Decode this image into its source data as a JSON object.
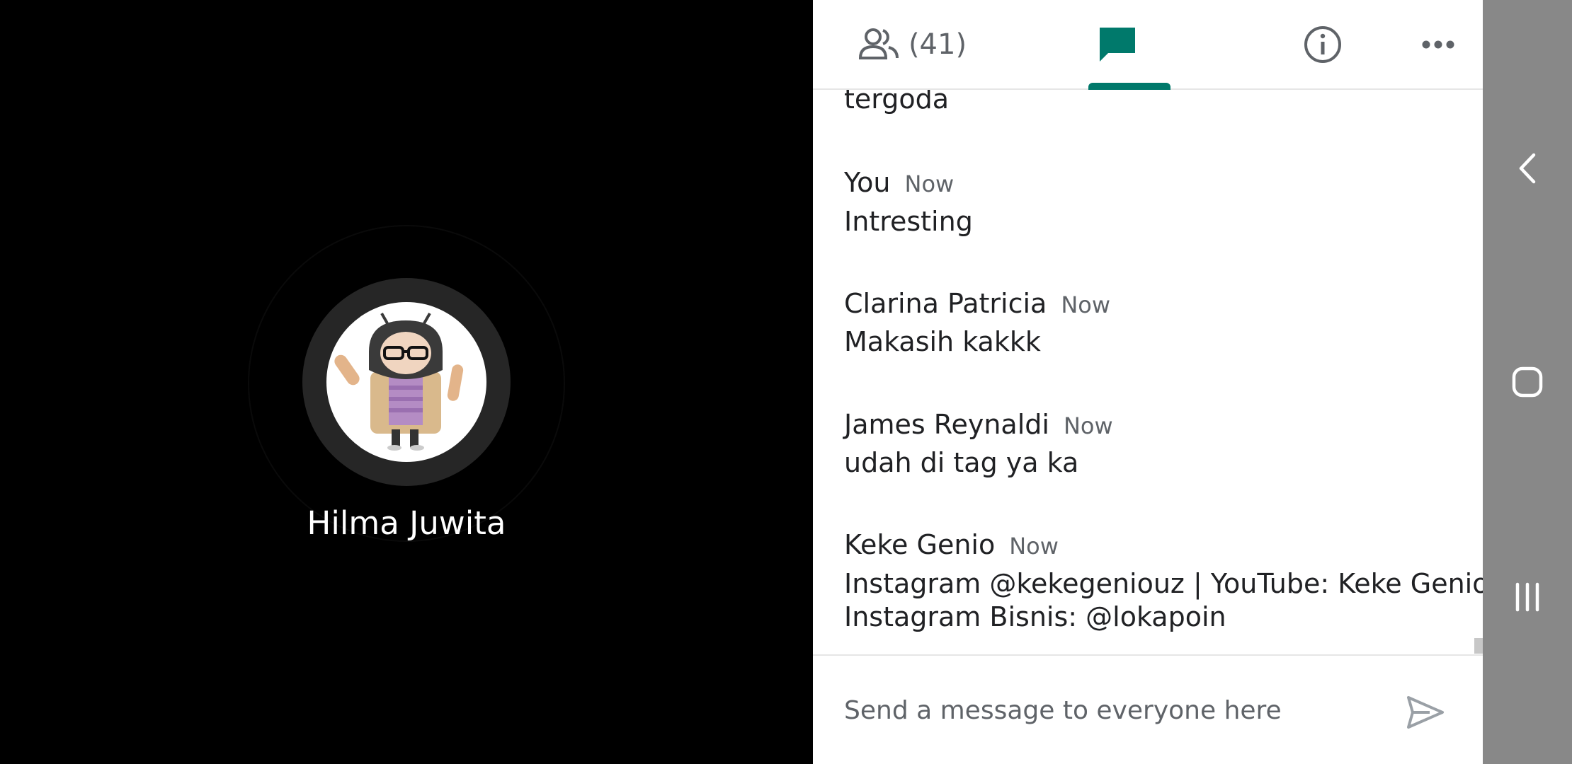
{
  "stage": {
    "participant_name": "Hilma Juwita",
    "avatar_icon": "android-girl-avatar-icon"
  },
  "tabs": {
    "people_count": "(41)",
    "people_icon": "people-icon",
    "chat_icon": "chat-icon",
    "info_icon": "info-icon",
    "more_icon": "more-horizontal-icon",
    "active": "chat"
  },
  "chat": {
    "partial_text": "tergoda",
    "messages": [
      {
        "sender": "You",
        "time": "Now",
        "lines": [
          "Intresting"
        ]
      },
      {
        "sender": "Clarina Patricia",
        "time": "Now",
        "lines": [
          "Makasih kakkk"
        ]
      },
      {
        "sender": "James Reynaldi",
        "time": "Now",
        "lines": [
          "udah di tag ya ka"
        ]
      },
      {
        "sender": "Keke Genio",
        "time": "Now",
        "lines": [
          "Instagram @kekegeniouz | YouTube: Keke Genio",
          "Instagram Bisnis: @lokapoin"
        ]
      }
    ]
  },
  "composer": {
    "placeholder": "Send a message to everyone here",
    "send_icon": "send-icon"
  },
  "nav": {
    "back_icon": "back-icon",
    "home_icon": "home-icon",
    "recents_icon": "recents-icon"
  },
  "colors": {
    "accent": "#00796b",
    "panel_bg": "#ffffff",
    "stage_bg": "#000000",
    "navbar_bg": "#888888"
  }
}
